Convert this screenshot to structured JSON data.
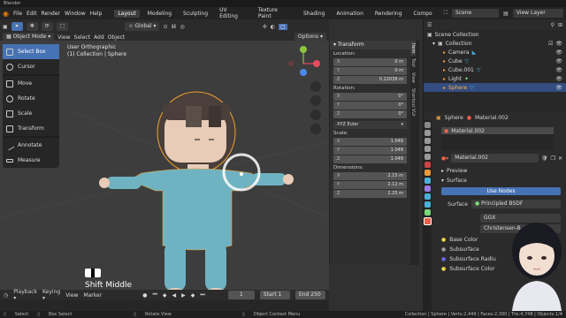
{
  "window": {
    "title": "Blender"
  },
  "menu": {
    "items": [
      "File",
      "Edit",
      "Render",
      "Window",
      "Help"
    ]
  },
  "workspaces": {
    "tabs": [
      "Layout",
      "Modeling",
      "Sculpting",
      "UV Editing",
      "Texture Paint",
      "Shading",
      "Animation",
      "Rendering",
      "Compo"
    ],
    "active": "Layout"
  },
  "scene": {
    "name": "Scene",
    "view_layer": "View Layer"
  },
  "viewport_header": {
    "mode": "Object Mode",
    "menus": [
      "View",
      "Select",
      "Add",
      "Object"
    ],
    "transform_orientation": "Global",
    "options": "Options"
  },
  "viewport": {
    "view_name": "User Orthographic",
    "collection_info": "(1) Collection | Sphere",
    "shortcut_overlay": "Shift Middle"
  },
  "tools": [
    {
      "label": "Select Box",
      "icon": "select-box-icon",
      "active": true
    },
    {
      "label": "Cursor",
      "icon": "cursor-icon"
    },
    {
      "label": "Move",
      "icon": "move-icon"
    },
    {
      "label": "Rotate",
      "icon": "rotate-icon"
    },
    {
      "label": "Scale",
      "icon": "scale-icon"
    },
    {
      "label": "Transform",
      "icon": "transform-icon"
    },
    {
      "label": "Annotate",
      "icon": "annotate-icon"
    },
    {
      "label": "Measure",
      "icon": "measure-icon"
    }
  ],
  "transform_panel": {
    "title": "Transform",
    "location_label": "Location:",
    "location": [
      {
        "axis": "X",
        "value": "0 m"
      },
      {
        "axis": "Y",
        "value": "0 m"
      },
      {
        "axis": "Z",
        "value": "0.22038 m"
      }
    ],
    "rotation_label": "Rotation:",
    "rotation": [
      {
        "axis": "X",
        "value": "0°"
      },
      {
        "axis": "Y",
        "value": "0°"
      },
      {
        "axis": "Z",
        "value": "0°"
      }
    ],
    "rotation_mode": "XYZ Euler",
    "scale_label": "Scale:",
    "scale": [
      {
        "axis": "X",
        "value": "1.049"
      },
      {
        "axis": "Y",
        "value": "1.049"
      },
      {
        "axis": "Z",
        "value": "1.049"
      }
    ],
    "dimensions_label": "Dimensions:",
    "dimensions": [
      {
        "axis": "X",
        "value": "2.15 m"
      },
      {
        "axis": "Y",
        "value": "2.12 m"
      },
      {
        "axis": "Z",
        "value": "2.25 m"
      }
    ]
  },
  "side_tabs": [
    "Item",
    "Tool",
    "View",
    "Shortcut VUr"
  ],
  "outliner": {
    "root": "Scene Collection",
    "items": [
      {
        "name": "Collection",
        "indent": 1
      },
      {
        "name": "Camera",
        "indent": 2
      },
      {
        "name": "Cube",
        "indent": 2
      },
      {
        "name": "Cube.001",
        "indent": 2
      },
      {
        "name": "Light",
        "indent": 2
      },
      {
        "name": "Sphere",
        "indent": 2,
        "selected": true
      }
    ]
  },
  "properties": {
    "object_name": "Sphere",
    "material_name": "Material.002",
    "slot": "Material.002",
    "material_field": "Material.002",
    "sections": [
      "Preview",
      "Surface"
    ],
    "use_nodes": "Use Nodes",
    "surface_label": "Surface",
    "surface_value": "Principled BSDF",
    "distribution": "GGX",
    "subsurface_method": "Christensen-B",
    "rows": [
      "Base Color",
      "Subsurface",
      "Subsurface Radiu",
      "Subsurface Color"
    ]
  },
  "timeline": {
    "menus": [
      "Playback",
      "Keying",
      "View",
      "Marker"
    ],
    "current_frame": "1",
    "start_label": "Start",
    "start": "1",
    "end_label": "End",
    "end": "250"
  },
  "status_bar": {
    "select": "Select",
    "box_select": "Box Select",
    "rotate_view": "Rotate View",
    "context_menu": "Object Context Menu",
    "stats": "Collection | Sphere | Verts:2,449 | Faces:2,390 | Tris:4,748 | Objects:1/4"
  },
  "colors": {
    "accent": "#4772b3",
    "character_skin": "#e8ccb8",
    "character_body": "#6fb3c2",
    "character_hair": "#4a3f3a",
    "selection_outline": "#f0a030"
  }
}
